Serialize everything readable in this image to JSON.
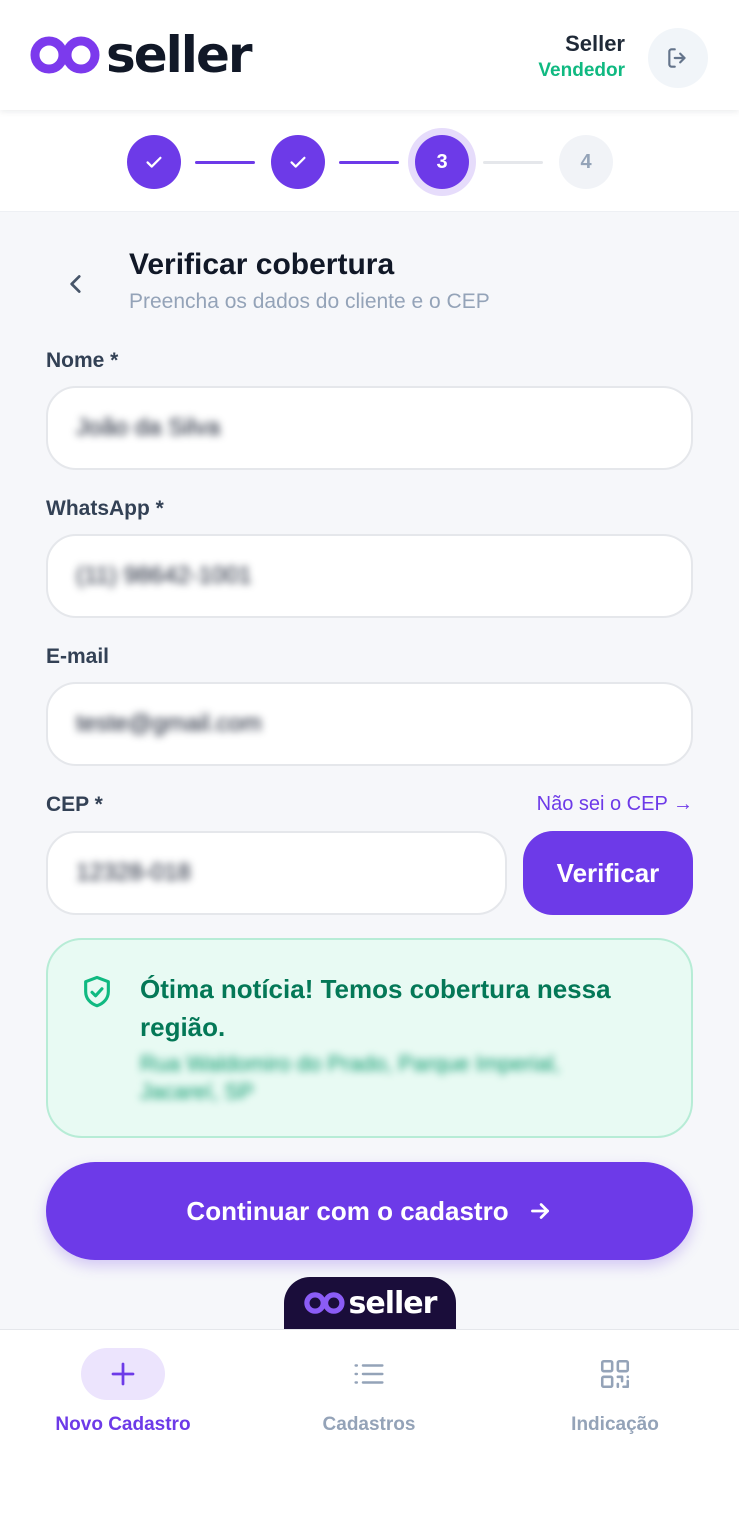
{
  "header": {
    "logo_text": "seller",
    "user_name": "Seller",
    "user_role": "Vendedor",
    "role_color": "#10b981",
    "logout_icon": "logout-icon"
  },
  "stepper": {
    "steps": [
      {
        "label": "",
        "state": "done"
      },
      {
        "label": "",
        "state": "done"
      },
      {
        "label": "3",
        "state": "active"
      },
      {
        "label": "4",
        "state": "todo"
      }
    ]
  },
  "page": {
    "title": "Verificar cobertura",
    "subtitle": "Preencha os dados do cliente e o CEP"
  },
  "form": {
    "name_label": "Nome *",
    "name_value": "João da Silva",
    "whatsapp_label": "WhatsApp *",
    "whatsapp_value": "(11) 98642-1001",
    "email_label": "E-mail",
    "email_value": "teste@gmail.com",
    "cep_label": "CEP *",
    "cep_value": "12328-018",
    "cep_help_link": "Não sei o CEP →",
    "verify_button": "Verificar"
  },
  "coverage": {
    "title": "Ótima notícia! Temos cobertura nessa região.",
    "address": "Rua Waldomiro do Prado, Parque Imperial, Jacareí, SP",
    "icon": "shield-check-icon"
  },
  "actions": {
    "continue_button": "Continuar com o cadastro"
  },
  "brand_tab": {
    "text": "seller"
  },
  "bottom_nav": {
    "items": [
      {
        "label": "Novo Cadastro",
        "icon": "plus-icon",
        "active": true
      },
      {
        "label": "Cadastros",
        "icon": "list-icon",
        "active": false
      },
      {
        "label": "Indicação",
        "icon": "qr-code-icon",
        "active": false
      }
    ]
  },
  "colors": {
    "accent": "#6d3ae8",
    "success": "#047857",
    "background": "#f6f7fa"
  }
}
